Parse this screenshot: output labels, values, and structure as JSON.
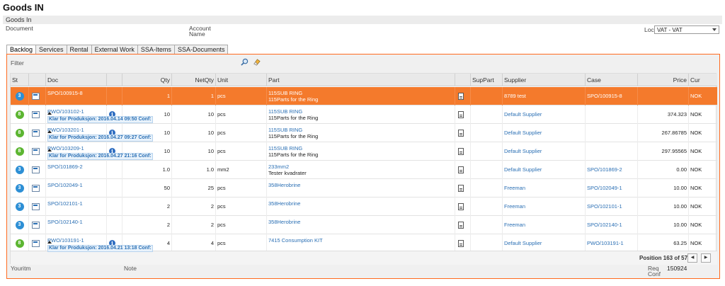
{
  "page": {
    "title": "Goods IN",
    "subtitle": "Goods In"
  },
  "form": {
    "document_label": "Document",
    "account_label_1": "Account",
    "account_label_2": "Name",
    "loc_label": "Loc",
    "loc_value": "VAT - VAT"
  },
  "tabs": [
    "Backlog",
    "Services",
    "Rental",
    "External Work",
    "SSA-Items",
    "SSA-Documents"
  ],
  "active_tab": "Backlog",
  "filter_label": "Filter",
  "columns": {
    "st": "St",
    "doc": "Doc",
    "qty": "Qty",
    "netqty": "NetQty",
    "unit": "Unit",
    "part": "Part",
    "suppart": "SupPart",
    "supplier": "Supplier",
    "case": "Case",
    "price": "Price",
    "cur": "Cur"
  },
  "rows": [
    {
      "st": "3",
      "st_color": "blue",
      "doc": "SPO/100915-8",
      "note": "",
      "info": false,
      "qty": "1",
      "netqty": "1",
      "unit": "pcs",
      "part1": "115SUB RING",
      "part2": "115Parts for the Ring",
      "supplier": "8789 test",
      "case": "SPO/100915-8",
      "price": "",
      "cur": "NOK",
      "selected": true
    },
    {
      "st": "8",
      "st_color": "green",
      "doc": "PWO/103102-1",
      "note": "Klar for Produksjon: 2016.04.14 09:50 Conf:",
      "info": true,
      "qty": "10",
      "netqty": "10",
      "unit": "pcs",
      "part1": "115SUB RING",
      "part2": "115Parts for the Ring",
      "supplier": "Default Supplier",
      "case": "",
      "price": "374.323",
      "cur": "NOK",
      "selected": false
    },
    {
      "st": "8",
      "st_color": "green",
      "doc": "PWO/103201-1",
      "note": "Klar for Produksjon: 2016.04.27 09:27 Conf:",
      "info": true,
      "qty": "10",
      "netqty": "10",
      "unit": "pcs",
      "part1": "115SUB RING",
      "part2": "115Parts for the Ring",
      "supplier": "Default Supplier",
      "case": "",
      "price": "267.86785",
      "cur": "NOK",
      "selected": false
    },
    {
      "st": "8",
      "st_color": "green",
      "doc": "PWO/103209-1",
      "note": "Klar for Produksjon: 2016.04.27 21:16 Conf:",
      "info": true,
      "qty": "10",
      "netqty": "10",
      "unit": "pcs",
      "part1": "115SUB RING",
      "part2": "115Parts for the Ring",
      "supplier": "Default Supplier",
      "case": "",
      "price": "297.95565",
      "cur": "NOK",
      "selected": false
    },
    {
      "st": "3",
      "st_color": "blue",
      "doc": "SPO/101869-2",
      "note": "",
      "info": false,
      "qty": "1.0",
      "netqty": "1.0",
      "unit": "mm2",
      "part1": "233mm2",
      "part2": "Tester kvadrater",
      "supplier": "Default Supplier",
      "case": "SPO/101869-2",
      "price": "0.00",
      "cur": "NOK",
      "selected": false
    },
    {
      "st": "3",
      "st_color": "blue",
      "doc": "SPO/102049-1",
      "note": "",
      "info": false,
      "qty": "50",
      "netqty": "25",
      "unit": "pcs",
      "part1": "358Herobrine",
      "part2": "",
      "supplier": "Freeman",
      "case": "SPO/102049-1",
      "price": "10.00",
      "cur": "NOK",
      "selected": false
    },
    {
      "st": "3",
      "st_color": "blue",
      "doc": "SPO/102101-1",
      "note": "",
      "info": false,
      "qty": "2",
      "netqty": "2",
      "unit": "pcs",
      "part1": "358Herobrine",
      "part2": "",
      "supplier": "Freeman",
      "case": "SPO/102101-1",
      "price": "10.00",
      "cur": "NOK",
      "selected": false
    },
    {
      "st": "3",
      "st_color": "blue",
      "doc": "SPO/102140-1",
      "note": "",
      "info": false,
      "qty": "2",
      "netqty": "2",
      "unit": "pcs",
      "part1": "358Herobrine",
      "part2": "",
      "supplier": "Freeman",
      "case": "SPO/102140-1",
      "price": "10.00",
      "cur": "NOK",
      "selected": false
    },
    {
      "st": "8",
      "st_color": "green",
      "doc": "PWO/103191-1",
      "note": "Klar for Produksjon: 2016.04.21 13:18 Conf:",
      "info": true,
      "qty": "4",
      "netqty": "4",
      "unit": "pcs",
      "part1": "7415 Consumption KIT",
      "part2": "",
      "supplier": "Default Supplier",
      "case": "PWO/103191-1",
      "price": "63.25",
      "cur": "NOK",
      "selected": false
    }
  ],
  "pager": {
    "position": "Position 163 of 577",
    "prev": "◀",
    "next": "▶"
  },
  "bottom": {
    "youritm_label": "Youritm",
    "note_label": "Note",
    "req_label": "Req",
    "conf_label": "Conf",
    "req_value": "150924"
  },
  "colors": {
    "accent": "#f47a2c",
    "link": "#2a6fb4",
    "badge_blue": "#2d8fd5",
    "badge_green": "#5cb531"
  }
}
